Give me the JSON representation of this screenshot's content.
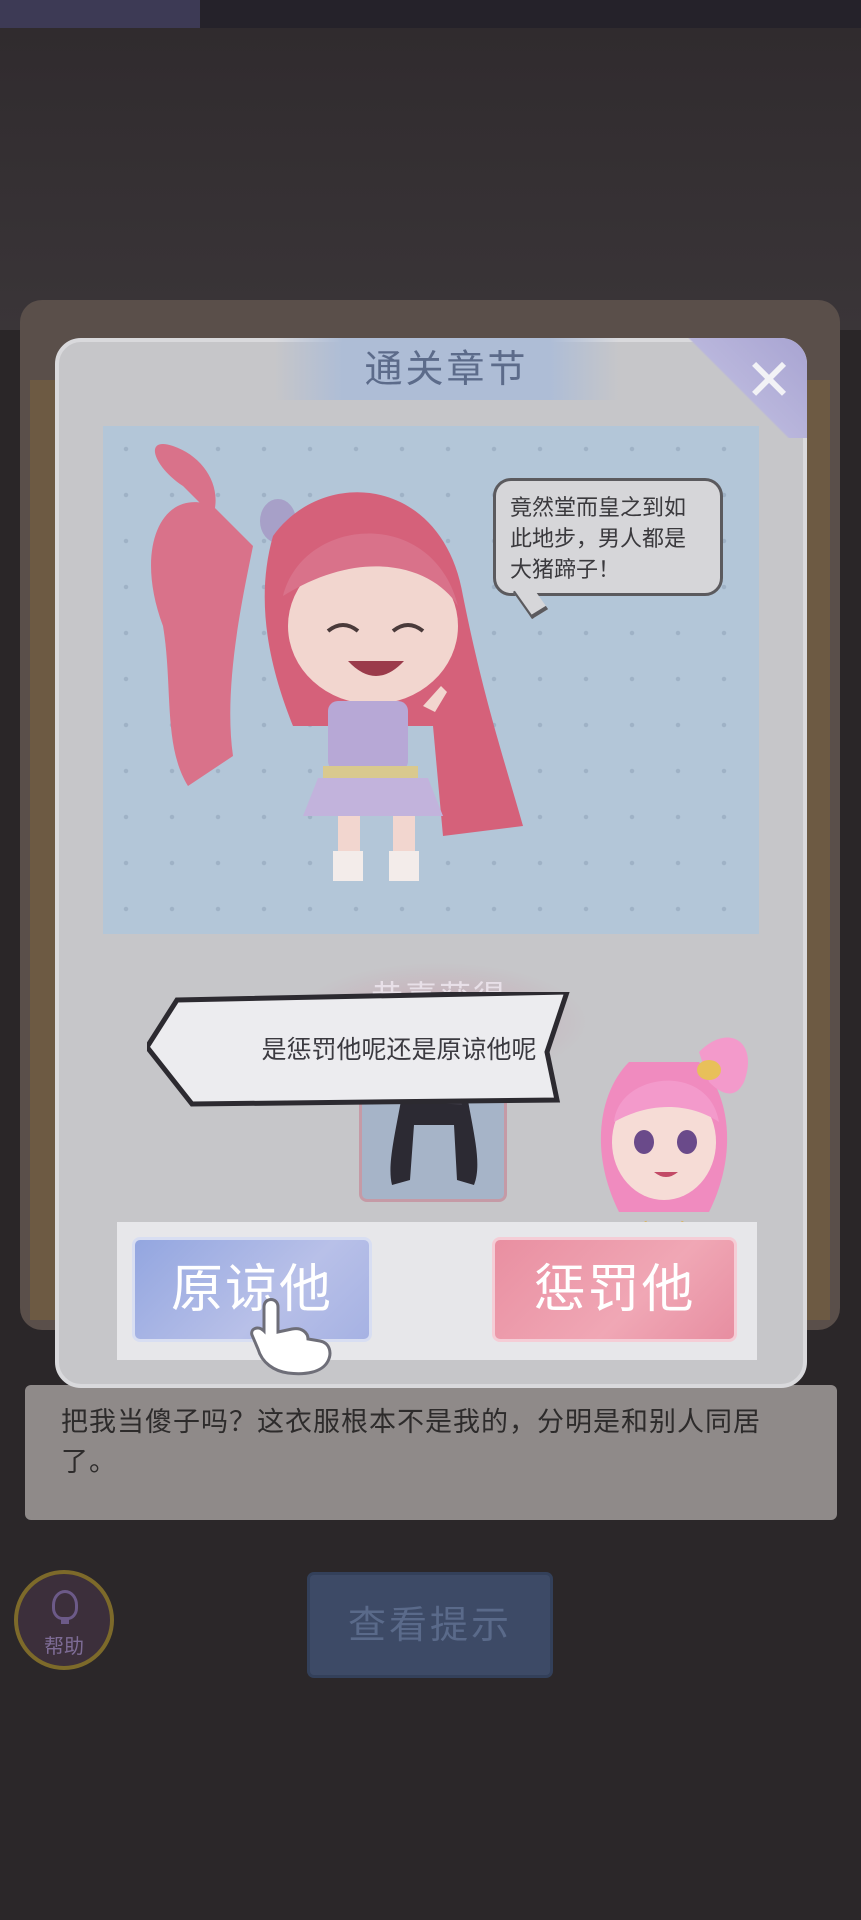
{
  "dialog": {
    "title": "通关章节",
    "close_icon": "close-icon"
  },
  "comic": {
    "speech": "竟然堂而皇之到如此地步，男人都是大猪蹄子！"
  },
  "reward": {
    "title": "恭喜获得",
    "item": "black-long-wig"
  },
  "prompt": {
    "text": "是惩罚他呢还是原谅他呢"
  },
  "choices": {
    "forgive_label": "原谅他",
    "punish_label": "惩罚他"
  },
  "story": {
    "text": "把我当傻子吗？这衣服根本不是我的，分明是和别人同居了。"
  },
  "controls": {
    "help_label": "帮助",
    "hint_label": "查看提示"
  },
  "colors": {
    "forgive": "#93a6e0",
    "punish": "#e98fa1",
    "title": "#5c6b8a"
  }
}
